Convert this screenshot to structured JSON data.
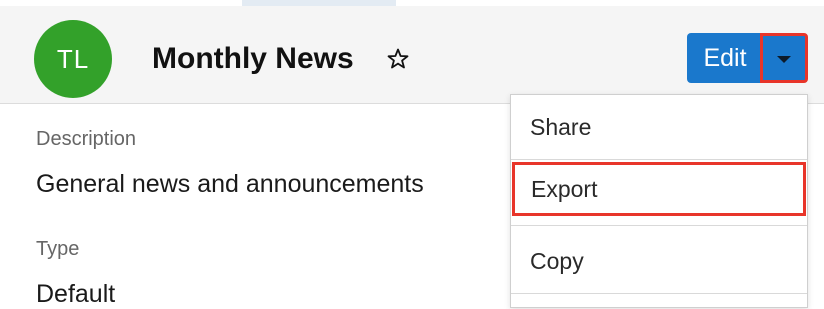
{
  "header": {
    "avatar_initials": "TL",
    "title": "Monthly News",
    "favorite_icon": "star-outline-icon",
    "edit_label": "Edit",
    "dropdown_icon": "caret-down-icon"
  },
  "record": {
    "fields": [
      {
        "label": "Description",
        "value": "General news and announcements"
      },
      {
        "label": "Type",
        "value": "Default"
      }
    ]
  },
  "action_menu": {
    "items": [
      {
        "label": "Share"
      },
      {
        "label": "Export",
        "highlighted": true
      },
      {
        "label": "Copy"
      }
    ]
  },
  "colors": {
    "avatar": "#33a12a",
    "primary_button": "#1a78cc",
    "highlight_outline": "#e8352a",
    "header_background": "#f5f5f5"
  }
}
